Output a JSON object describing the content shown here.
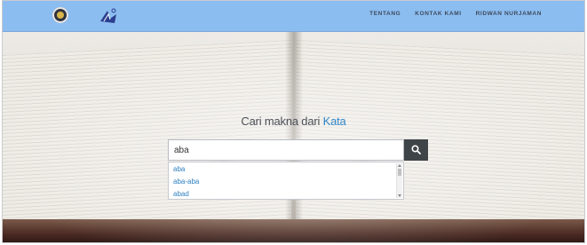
{
  "nav": {
    "links": [
      "TENTANG",
      "KONTAK KAMI",
      "RIDWAN NURJAMAN"
    ]
  },
  "hero": {
    "headline_main": "Cari makna dari",
    "headline_accent": "Kata"
  },
  "search": {
    "value": "aba",
    "placeholder": ""
  },
  "suggestions": [
    "aba",
    "aba-aba",
    "abad"
  ],
  "colors": {
    "navbar": "#8cbdf0",
    "accent": "#2f86c9",
    "search_button": "#3f4448"
  },
  "icons": {
    "logo_left": "gear-logo-icon",
    "logo_right": "book-logo-icon",
    "search": "search-icon"
  }
}
